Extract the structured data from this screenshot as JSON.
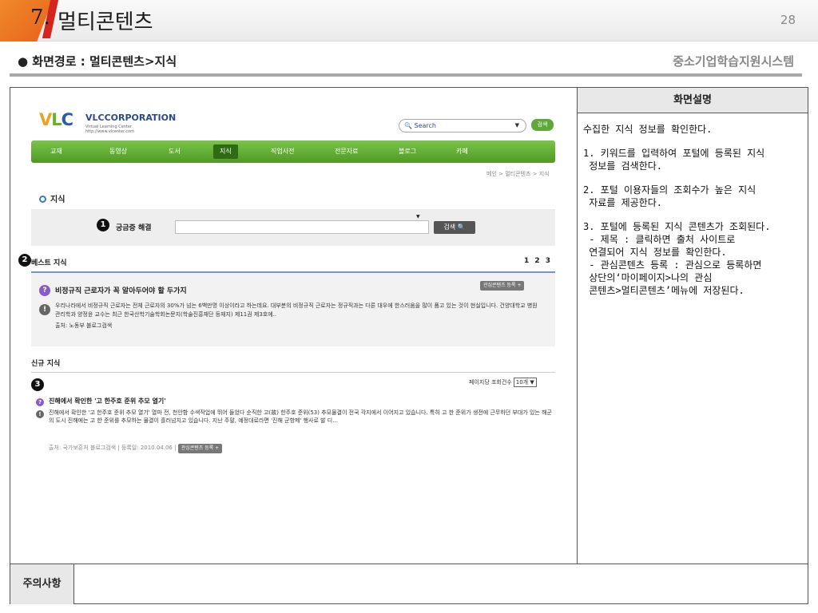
{
  "header": {
    "number": "7.",
    "title": "멀티콘텐츠",
    "page": "28"
  },
  "path": "● 화면경로 : 멀티콘텐츠>지식",
  "system_name": "중소기업학습지원시스템",
  "side": {
    "heading": "화면설명",
    "paragraphs": [
      "수집한 지식 정보를 확인한다.",
      "1. 키워드를 입력하여 포털에 등록된 지식\n 정보를 검색한다.",
      "2. 포털 이용자들의 조회수가 높은 지식\n 자료를 제공한다.",
      "3. 포털에 등록된 지식 콘텐츠가 조회된다.\n - 제목 : 클릭하면 출처 사이트로\n 연결되어 지식 정보를 확인한다.\n - 관심콘텐츠 등록 : 관심으로 등록하면\n 상단의‘마이페이지>나의 관심\n 콘텐츠>멀티콘텐츠’메뉴에 저장된다."
    ]
  },
  "notes_label": "주의사항",
  "portal": {
    "logo": {
      "v": "V",
      "l": "L",
      "c": "C",
      "corp": "VLCCORPORATION",
      "sub": "Virtual Learning Center http://www.vlcenter.com"
    },
    "search_placeholder": "Search",
    "search_button": "검색",
    "nav": [
      "교재",
      "동영상",
      "도서",
      "지식",
      "직업사전",
      "전문자료",
      "블로그",
      "카페"
    ],
    "breadcrumb": "메인 > 멀티콘텐츠 > 지식",
    "section": "지식",
    "query_label": "궁금증 해결",
    "query_button": "검색",
    "badges": [
      "1",
      "2",
      "3"
    ],
    "best": {
      "title": "베스트 지식",
      "pages": "1 2 3",
      "item_title": "비정규직 근로자가 꼭 알아두어야 할 두가지",
      "tag": "관심콘텐츠 등록 +",
      "text": "우리나라에서 비정규직 근로자는 전체 근로자의 30%가 넘는 6백만명 이상이라고 하는데요. 대부분의 비정규직 근로자는 정규직과는 다른 대우에 한스러움을 많이 품고 있는 것이 현실입니다. 건양대학교 병원관리학과 양정윤 교수는 최근 한국산학기술학회논문지(학술진흥재단 등재지) 제11권 제3호에..",
      "source": "출처: 노동부 블로그검색"
    },
    "new": {
      "title": "신규 지식",
      "per_page_label": "페이지당 조회건수",
      "per_page_value": "10개",
      "item_title": "진해에서 확인한 '고 한주호 준위 추모 열기'",
      "text": "진해에서 확인한 '고 한주호 준위 추모 열기' 열마 전, 천안함 수색작업에 뛰어 들었다 순직한 고(故) 한주호 준위(53) 추모물결이 전국 각지에서 이어지고 있습니다. 특히 고 한 준위가 생전에 근무하던 부대가 있는 해군의 도시 진해에는 고 한 준위를 추모하는 물결이 흘러넘치고 있습니다. 지난 주말, 예정대로라면 '진해 군항제' 행사로 발 디...",
      "source": "출처: 국가보훈처 블로그검색 | 등록일: 2010.04.06 |",
      "tag": "관심콘텐츠 등록 +"
    }
  }
}
